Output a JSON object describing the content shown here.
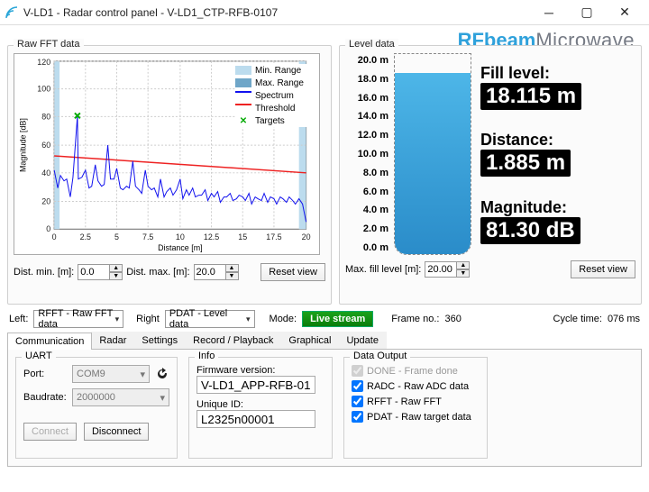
{
  "window": {
    "title": "V-LD1 - Radar control panel - V-LD1_CTP-RFB-0107"
  },
  "brand": {
    "a": "RFbeam",
    "b": "Microwave"
  },
  "left_chart": {
    "title": "Raw FFT data",
    "xlabel": "Distance [m]",
    "ylabel": "Magnitude [dB]",
    "legend": {
      "min": "Min. Range",
      "max": "Max. Range",
      "spectrum": "Spectrum",
      "threshold": "Threshold",
      "targets": "Targets"
    }
  },
  "dist_min": {
    "label": "Dist. min. [m]:",
    "value": "0.0"
  },
  "dist_max": {
    "label": "Dist. max. [m]:",
    "value": "20.0"
  },
  "reset_view": "Reset view",
  "right_panel": {
    "title": "Level data",
    "scale": [
      "20.0 m",
      "18.0 m",
      "16.0 m",
      "14.0 m",
      "12.0 m",
      "10.0 m",
      "8.0 m",
      "6.0 m",
      "4.0 m",
      "2.0 m",
      "0.0 m"
    ],
    "fill_label": "Fill level:",
    "fill_value": "18.115 m",
    "dist_label": "Distance:",
    "dist_value": "1.885 m",
    "mag_label": "Magnitude:",
    "mag_value": "81.30 dB",
    "max_fill_label": "Max. fill level [m]:",
    "max_fill_value": "20.00"
  },
  "mid": {
    "left_label": "Left:",
    "left_value": "RFFT - Raw FFT data",
    "right_label": "Right",
    "right_value": "PDAT - Level data",
    "mode_label": "Mode:",
    "mode_value": "Live stream",
    "frame_label": "Frame no.:",
    "frame_value": "360",
    "cycle_label": "Cycle time:",
    "cycle_value": "076 ms"
  },
  "tabs": [
    "Communication",
    "Radar",
    "Settings",
    "Record / Playback",
    "Graphical",
    "Update"
  ],
  "uart": {
    "title": "UART",
    "port_label": "Port:",
    "port_value": "COM9",
    "baud_label": "Baudrate:",
    "baud_value": "2000000",
    "connect": "Connect",
    "disconnect": "Disconnect"
  },
  "info": {
    "title": "Info",
    "fw_label": "Firmware version:",
    "fw_value": "V-LD1_APP-RFB-0107",
    "uid_label": "Unique ID:",
    "uid_value": "L2325n00001"
  },
  "dout": {
    "title": "Data Output",
    "done": "DONE - Frame done",
    "radc": "RADC - Raw ADC data",
    "rfft": "RFFT - Raw FFT",
    "pdat": "PDAT - Raw target data"
  },
  "chart_data": {
    "type": "line",
    "xlabel": "Distance [m]",
    "ylabel": "Magnitude [dB]",
    "xlim": [
      0,
      20
    ],
    "ylim": [
      0,
      120
    ],
    "series": [
      {
        "name": "Spectrum",
        "x": [
          0,
          0.5,
          1,
          1.5,
          1.8,
          2,
          2.5,
          3,
          3.5,
          4,
          4.5,
          5,
          5.5,
          6,
          6.5,
          7,
          7.5,
          8,
          8.5,
          9,
          9.5,
          10,
          10.5,
          11,
          11.5,
          12,
          12.5,
          13,
          13.5,
          14,
          14.5,
          15,
          15.5,
          16,
          16.5,
          17,
          17.5,
          18,
          18.5,
          19,
          19.5,
          20
        ],
        "y": [
          42,
          38,
          40,
          35,
          81,
          38,
          42,
          30,
          46,
          32,
          60,
          36,
          44,
          28,
          34,
          30,
          48,
          26,
          28,
          42,
          24,
          36,
          22,
          28,
          30,
          24,
          26,
          22,
          28,
          20,
          26,
          22,
          24,
          20,
          26,
          18,
          22,
          20,
          24,
          18,
          22,
          6
        ]
      },
      {
        "name": "Threshold",
        "x": [
          0,
          20
        ],
        "y": [
          52,
          40
        ]
      }
    ],
    "min_range_band_x": [
      0,
      0.4
    ],
    "max_range_band_x": [
      19.5,
      20
    ],
    "targets": [
      {
        "x": 1.885,
        "y": 81.3
      }
    ]
  }
}
